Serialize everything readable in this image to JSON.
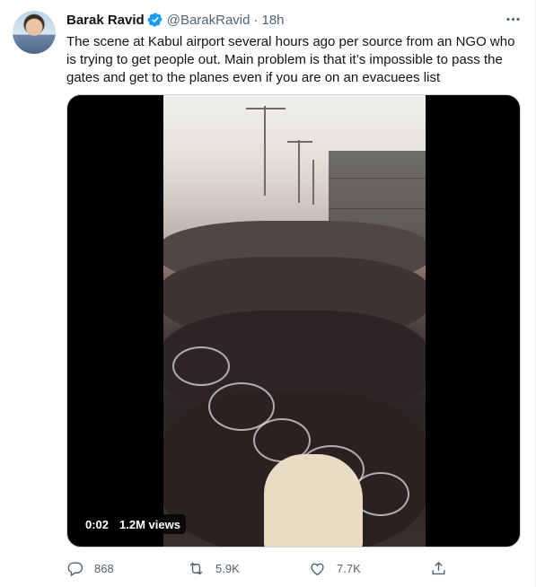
{
  "tweet": {
    "author_name": "Barak Ravid",
    "handle": "@BarakRavid",
    "separator": "·",
    "time": "18h",
    "text": "The scene at Kabul airport several hours ago per source from an NGO who is trying to get people out. Main problem is that it’s impossible to pass the gates and get to the planes even if you are on an evacuees list"
  },
  "media": {
    "timecode": "0:02",
    "views": "1.2M views"
  },
  "actions": {
    "replies": "868",
    "retweets": "5.9K",
    "likes": "7.7K"
  },
  "colors": {
    "verified": "#1d9bf0",
    "secondary_text": "#536471",
    "primary_text": "#0f1419"
  },
  "icons": [
    "verified-badge-icon",
    "more-icon",
    "reply-icon",
    "retweet-icon",
    "like-icon",
    "share-icon"
  ]
}
